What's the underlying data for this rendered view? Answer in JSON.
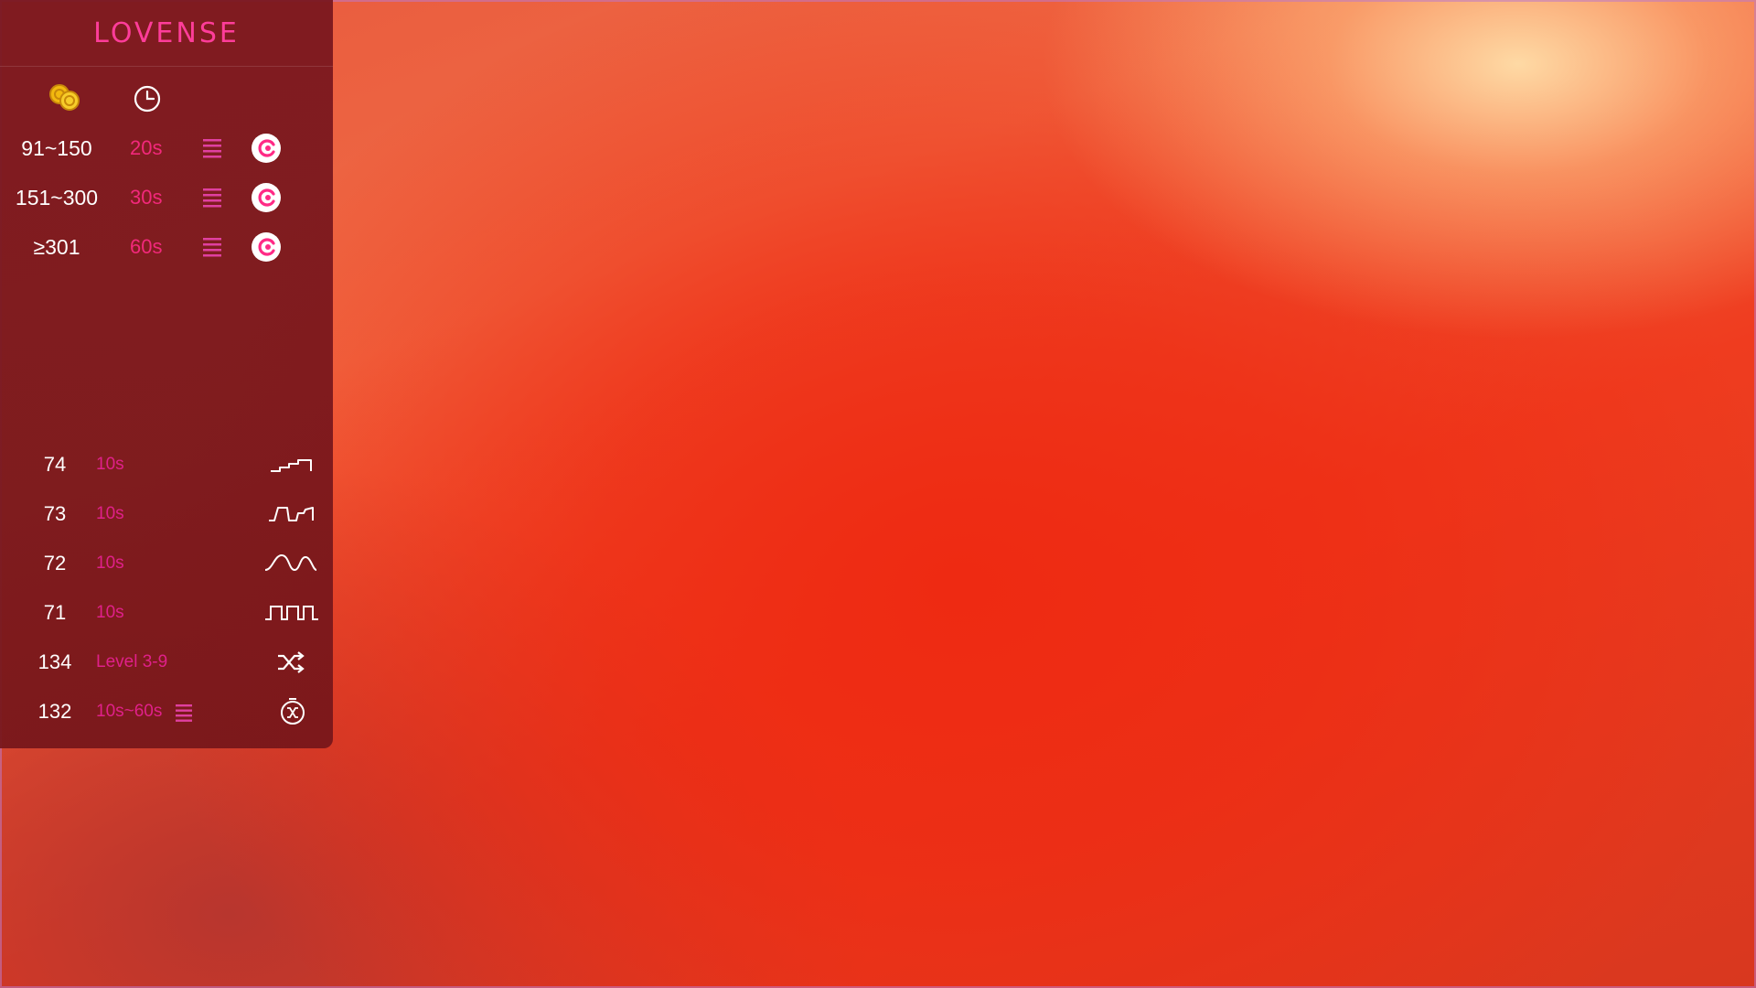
{
  "brand": {
    "logo_text": "LOVENSE",
    "color": "#ff3d9a"
  },
  "header_icons": [
    "coins-icon",
    "clock-icon"
  ],
  "levels": [
    {
      "range": "91~150",
      "duration": "20s",
      "menu_icon": "list-icon",
      "toy_icon": "lovense-toy-icon"
    },
    {
      "range": "151~300",
      "duration": "30s",
      "menu_icon": "list-icon",
      "toy_icon": "lovense-toy-icon"
    },
    {
      "range": "≥301",
      "duration": "60s",
      "menu_icon": "list-icon",
      "toy_icon": "lovense-toy-icon"
    }
  ],
  "commands": [
    {
      "number": "74",
      "label": "10s",
      "icon": "stair-pattern-icon"
    },
    {
      "number": "73",
      "label": "10s",
      "icon": "pulse-pattern-icon"
    },
    {
      "number": "72",
      "label": "10s",
      "icon": "wave-pattern-icon"
    },
    {
      "number": "71",
      "label": "10s",
      "icon": "square-wave-pattern-icon"
    },
    {
      "number": "134",
      "label": "Level 3-9",
      "icon": "shuffle-icon"
    },
    {
      "number": "132",
      "label": "10s~60s",
      "icon": "random-timer-icon",
      "menu_icon": "list-icon"
    }
  ],
  "colors": {
    "accent_pink": "#ff2a86",
    "panel_bg": "#78161e",
    "coin_gold": "#f5c518"
  }
}
